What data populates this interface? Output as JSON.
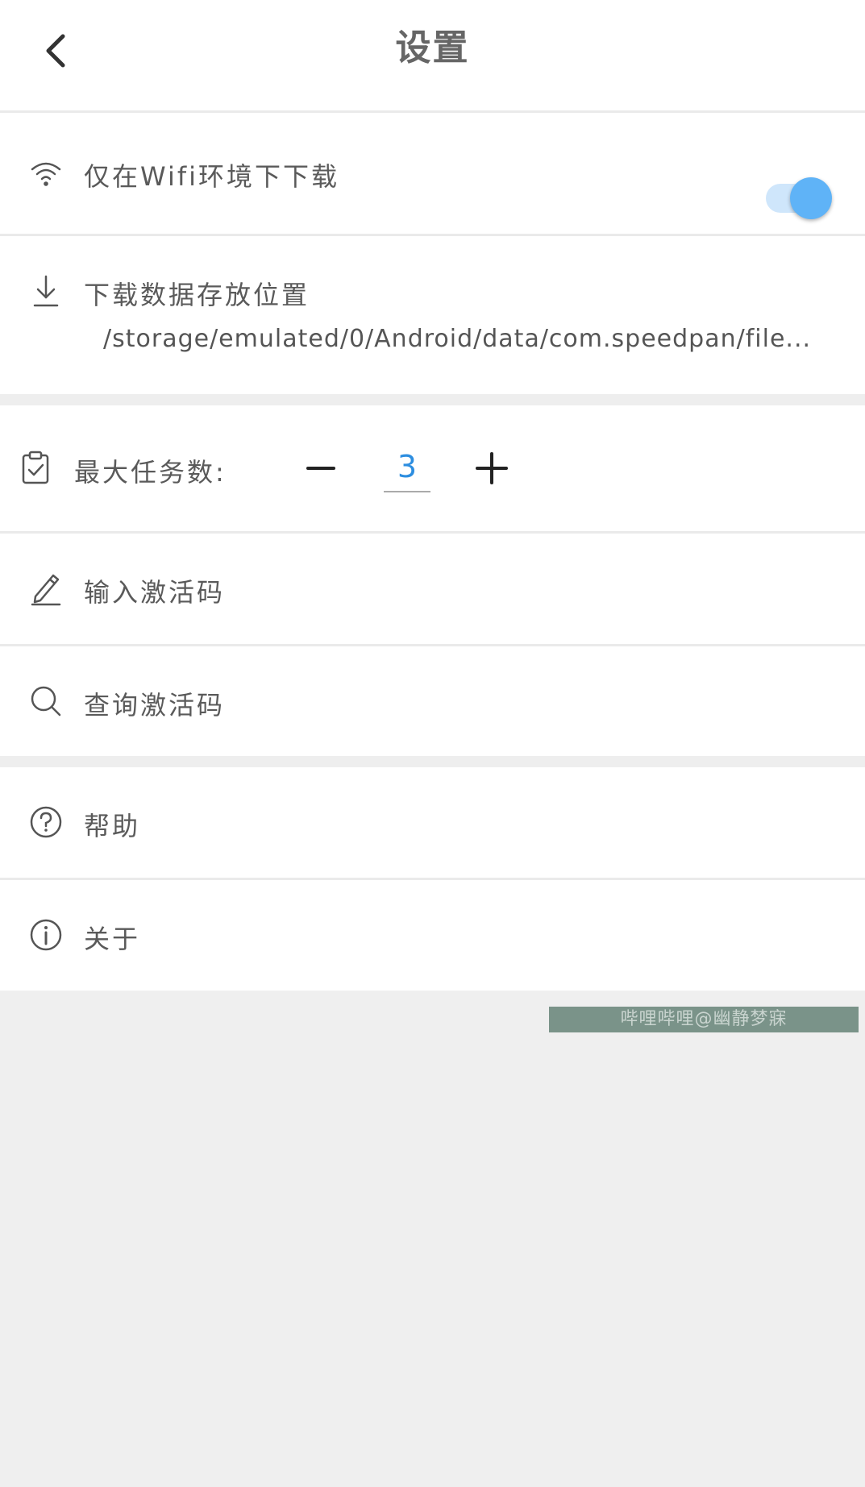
{
  "header": {
    "title": "设置"
  },
  "settings": {
    "wifi_only": {
      "label": "仅在Wifi环境下下载",
      "enabled": true
    },
    "download_location": {
      "label": "下载数据存放位置",
      "path": "/storage/emulated/0/Android/data/com.speedpan/file..."
    },
    "max_tasks": {
      "label": "最大任务数:",
      "value": "3",
      "decrement_label": "−",
      "increment_label": "+"
    },
    "enter_code": {
      "label": "输入激活码"
    },
    "query_code": {
      "label": "查询激活码"
    },
    "help": {
      "label": "帮助"
    },
    "about": {
      "label": "关于"
    }
  },
  "watermark": "哔哩哔哩@幽静梦寐",
  "colors": {
    "accent": "#5fb3f7",
    "value": "#2d8ee0",
    "background": "#efefef"
  },
  "icons": {
    "back": "chevron-left-icon",
    "wifi": "wifi-icon",
    "download": "download-icon",
    "tasks": "clipboard-check-icon",
    "edit": "pencil-icon",
    "search": "search-icon",
    "help": "question-circle-icon",
    "about": "info-circle-icon"
  }
}
